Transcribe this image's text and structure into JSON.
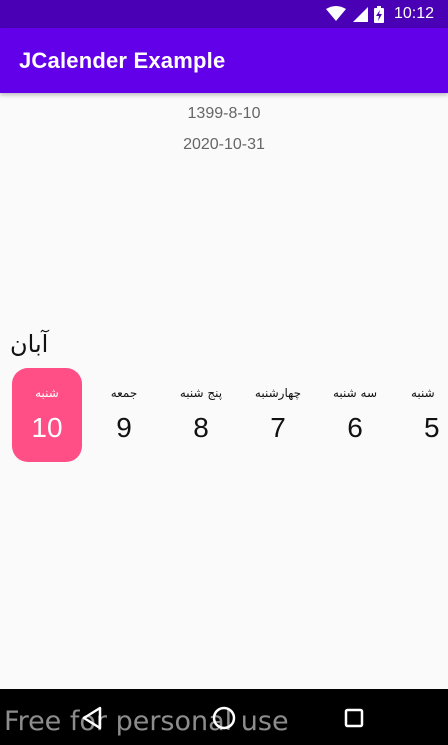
{
  "status_bar": {
    "time": "10:12",
    "icons": [
      "wifi-icon",
      "cell-signal-icon",
      "battery-charging-icon"
    ]
  },
  "app_bar": {
    "title": "JCalender Example"
  },
  "dates": {
    "persian": "1399-8-10",
    "gregorian": "2020-10-31"
  },
  "calendar": {
    "month": "آبان",
    "days": [
      {
        "name": "شنبه",
        "number": "10",
        "selected": true
      },
      {
        "name": "جمعه",
        "number": "9",
        "selected": false
      },
      {
        "name": "پنج شنبه",
        "number": "8",
        "selected": false
      },
      {
        "name": "چهارشنبه",
        "number": "7",
        "selected": false
      },
      {
        "name": "سه شنبه",
        "number": "6",
        "selected": false
      },
      {
        "name": "شنبه",
        "number": "5",
        "selected": false
      }
    ],
    "colors": {
      "selected_background": "#ff4f86",
      "selected_text": "#ffffff"
    }
  },
  "nav_bar": {
    "buttons": [
      "back-icon",
      "home-icon",
      "recents-icon"
    ]
  },
  "watermark": "Free for personal use",
  "colors": {
    "status_bar": "#4a00b5",
    "app_bar": "#6200ea"
  }
}
